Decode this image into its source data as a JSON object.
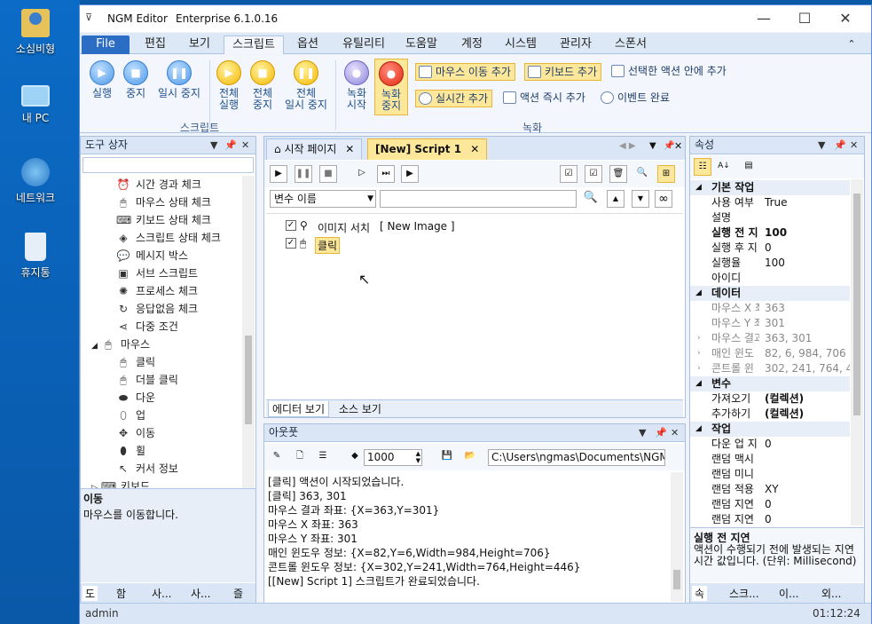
{
  "desktop": {
    "icons": [
      {
        "label": "소심비형",
        "icon": "user-folder-icon"
      },
      {
        "label": "내 PC",
        "icon": "computer-icon"
      },
      {
        "label": "네트워크",
        "icon": "network-icon"
      },
      {
        "label": "휴지통",
        "icon": "recycle-bin-icon"
      }
    ]
  },
  "window": {
    "app_name": "NGM Editor",
    "edition": "Enterprise 6.1.0.16",
    "minimize": "—",
    "maximize": "☐",
    "close": "✕",
    "collapse": "⌃"
  },
  "menu": [
    "File",
    "편집",
    "보기",
    "스크립트",
    "옵션",
    "유틸리티",
    "도움말",
    "계정",
    "시스템",
    "관리자",
    "스폰서"
  ],
  "ribbon": {
    "script_group": "스크립트",
    "record_group": "녹화",
    "buttons": {
      "run": "실행",
      "stop": "중지",
      "pause": "일시 중지",
      "run_all": [
        "전체",
        "실행"
      ],
      "stop_all": [
        "전체",
        "중지"
      ],
      "pause_all": [
        "전체",
        "일시 중지"
      ],
      "rec_start": [
        "녹화",
        "시작"
      ],
      "rec_stop": [
        "녹화",
        "중지"
      ]
    },
    "small": {
      "add_mouse": "마우스 이동 추가",
      "add_keyboard": "키보드 추가",
      "add_inside": "선택한 액션 안에 추가",
      "add_realtime": "실시간 추가",
      "add_action_now": "액션 즉시 추가",
      "event_done": "이벤트 완료"
    }
  },
  "toolbox": {
    "title": "도구 상자",
    "items": [
      {
        "label": "시간 경과 체크",
        "icon": "alarm-clock-icon"
      },
      {
        "label": "마우스 상태 체크",
        "icon": "mouse-pointer-icon"
      },
      {
        "label": "키보드 상태 체크",
        "icon": "keyboard-icon"
      },
      {
        "label": "스크립트 상태 체크",
        "icon": "script-status-icon"
      },
      {
        "label": "메시지 박스",
        "icon": "message-icon"
      },
      {
        "label": "서브 스크립트",
        "icon": "subscript-icon"
      },
      {
        "label": "프로세스 체크",
        "icon": "process-icon"
      },
      {
        "label": "응답없음 체크",
        "icon": "refresh-icon"
      },
      {
        "label": "다중 조건",
        "icon": "share-icon"
      },
      {
        "label": "마우스",
        "icon": "mouse-pointer-icon"
      },
      {
        "label": "클릭",
        "icon": "click-icon"
      },
      {
        "label": "더블 클릭",
        "icon": "double-click-icon"
      },
      {
        "label": "다운",
        "icon": "mouse-down-icon"
      },
      {
        "label": "업",
        "icon": "mouse-up-icon"
      },
      {
        "label": "이동",
        "icon": "move-icon"
      },
      {
        "label": "휠",
        "icon": "wheel-icon"
      },
      {
        "label": "커서 정보",
        "icon": "cursor-info-icon"
      },
      {
        "label": "키보드",
        "icon": "keyboard-icon"
      }
    ],
    "desc_title": "이동",
    "desc_text": "마우스를 이동합니다.",
    "tabs": [
      "도",
      "함",
      "사...",
      "사...",
      "즐"
    ]
  },
  "editor": {
    "tabs": [
      "시작 페이지",
      "[New] Script 1"
    ],
    "tab_close": "✕",
    "variable_select": "변수 이름",
    "actions": [
      {
        "label": "이미지 서치",
        "detail": "[ New Image ]",
        "checked": true
      },
      {
        "label": "클릭",
        "detail": "",
        "checked": true
      }
    ],
    "bottom_tabs": [
      "에디터 보기",
      "소스 보기"
    ]
  },
  "output": {
    "title": "아웃풋",
    "delay_value": "1000",
    "path": "C:\\Users\\ngmas\\Documents\\NGM6\\",
    "lines": [
      "[클릭] 액션이 시작되었습니다.",
      "[클릭] 363, 301",
      "마우스 결과 좌표: {X=363,Y=301}",
      "마우스 X 좌표: 363",
      "마우스 Y 좌표: 301",
      "매인 윈도우 정보: {X=82,Y=6,Width=984,Height=706}",
      "콘트롤 윈도우 정보: {X=302,Y=241,Width=764,Height=446}",
      "[[New] Script 1] 스크립트가 완료되었습니다."
    ]
  },
  "properties": {
    "title": "속성",
    "rows": [
      {
        "type": "cat",
        "k": "기본 작업",
        "v": ""
      },
      {
        "type": "row",
        "k": "사용 여부",
        "v": "True"
      },
      {
        "type": "row",
        "k": "설명",
        "v": ""
      },
      {
        "type": "bold",
        "k": "실행 전 지",
        "v": "100"
      },
      {
        "type": "row",
        "k": "실행 후 지",
        "v": "0"
      },
      {
        "type": "row",
        "k": "실행율",
        "v": "100"
      },
      {
        "type": "row",
        "k": "아이디",
        "v": ""
      },
      {
        "type": "cat",
        "k": "데이터",
        "v": ""
      },
      {
        "type": "dis",
        "k": "마우스 X 좌",
        "v": "363"
      },
      {
        "type": "dis",
        "k": "마우스 Y 좌",
        "v": "301"
      },
      {
        "type": "dis",
        "k": "마우스 결과",
        "v": "363, 301"
      },
      {
        "type": "dis",
        "k": "매인 윈도",
        "v": "82, 6, 984, 706"
      },
      {
        "type": "dis",
        "k": "콘트롤 윈",
        "v": "302, 241, 764, 446"
      },
      {
        "type": "cat",
        "k": "변수",
        "v": ""
      },
      {
        "type": "row",
        "k": "가져오기",
        "v": "(컬렉션)"
      },
      {
        "type": "row",
        "k": "추가하기",
        "v": "(컬렉션)"
      },
      {
        "type": "cat",
        "k": "작업",
        "v": ""
      },
      {
        "type": "row",
        "k": "다운 업 지",
        "v": "0"
      },
      {
        "type": "row",
        "k": "랜덤 맥시",
        "v": ""
      },
      {
        "type": "row",
        "k": "랜덤 미니",
        "v": ""
      },
      {
        "type": "row",
        "k": "랜덤 적용",
        "v": "XY"
      },
      {
        "type": "row",
        "k": "랜덤 지연",
        "v": "0"
      },
      {
        "type": "row",
        "k": "랜덤 지연",
        "v": "0"
      }
    ],
    "help_title": "실행 전 지연",
    "help_text": "액션이 수행되기 전에 발생되는 지연 시간 값입니다. (단위: Millisecond)",
    "tabs": [
      "속",
      "스크...",
      "이...",
      "외..."
    ]
  },
  "status": {
    "user": "admin",
    "time": "01:12:24"
  }
}
